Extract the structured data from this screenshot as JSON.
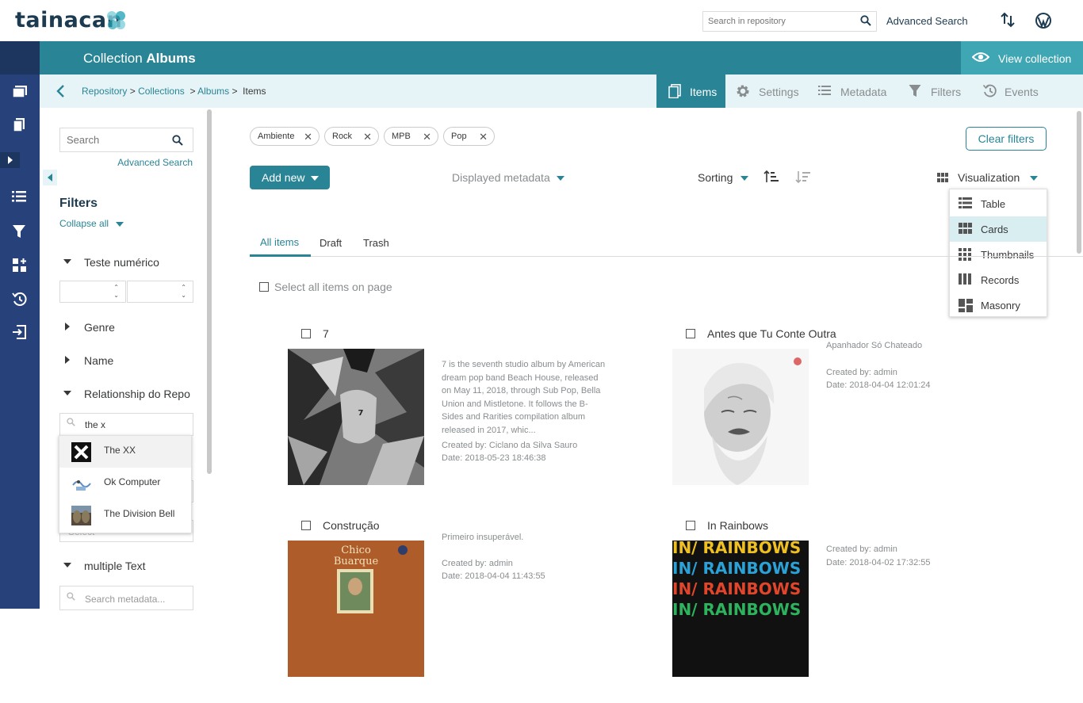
{
  "topbar": {
    "logo": "tainacan",
    "search_placeholder": "Search in repository",
    "advanced_search": "Advanced Search"
  },
  "collection_header": {
    "prefix": "Collection",
    "name": "Albums",
    "view_collection": "View collection"
  },
  "breadcrumb": {
    "repository": "Repository",
    "sep1": ">",
    "collections": "Collections",
    "sep2": ">",
    "albums": "Albums",
    "sep3": ">",
    "current": "Items"
  },
  "tabs": [
    {
      "label": "Items",
      "icon": "items-icon"
    },
    {
      "label": "Settings",
      "icon": "gear-icon"
    },
    {
      "label": "Metadata",
      "icon": "list-icon"
    },
    {
      "label": "Filters",
      "icon": "funnel-icon"
    },
    {
      "label": "Events",
      "icon": "history-icon"
    }
  ],
  "filters": {
    "search_placeholder": "Search",
    "advanced_search": "Advanced Search",
    "title": "Filters",
    "collapse_all": "Collapse all",
    "groups": [
      {
        "label": "Teste numérico",
        "expanded": true
      },
      {
        "label": "Genre",
        "expanded": false
      },
      {
        "label": "Name",
        "expanded": false
      },
      {
        "label": "Relationship do Repo",
        "expanded": true
      },
      {
        "label": "multiple Text",
        "expanded": true
      }
    ],
    "relationship_query": "the x",
    "relationship_results": [
      "The XX",
      "Ok Computer",
      "The Division Bell"
    ],
    "select_placeholder": "Select",
    "multi_placeholder": "Search metadata..."
  },
  "main": {
    "chips": [
      "Ambiente",
      "Rock",
      "MPB",
      "Pop"
    ],
    "clear_filters": "Clear filters",
    "add_new": "Add new",
    "displayed_metadata": "Displayed metadata",
    "sorting": "Sorting",
    "visualization": "Visualization",
    "visualization_options": [
      "Table",
      "Cards",
      "Thumbnails",
      "Records",
      "Masonry"
    ],
    "visualization_selected": "Cards",
    "status_tabs": [
      "All items",
      "Draft",
      "Trash"
    ],
    "select_all": "Select all items on page"
  },
  "items": [
    {
      "title": "7",
      "description": "7 is the seventh studio album by American dream pop band Beach House, released on May 11, 2018, through Sub Pop, Bella Union and Mistletone. It follows the B-Sides and Rarities compilation album released in 2017, whic...",
      "created_by": "Created by: Ciclano da Silva Sauro",
      "date": "Date: 2018-05-23 18:46:38"
    },
    {
      "title": "Antes que Tu Conte Outra",
      "description": "Apanhador Só Chateado",
      "created_by": "Created by: admin",
      "date": "Date: 2018-04-04 12:01:24"
    },
    {
      "title": "Construção",
      "description": "Primeiro insuperável.",
      "created_by": "Created by: admin",
      "date": "Date: 2018-04-04 11:43:55",
      "cover_text_1": "Chico",
      "cover_text_2": "Buarque"
    },
    {
      "title": "In Rainbows",
      "description": "",
      "created_by": "Created by: admin",
      "date": "Date: 2018-04-02 17:32:55",
      "cover_text": "IN/ RAINBOWS"
    }
  ],
  "colors": {
    "primary": "#298596",
    "nav": "#27427a",
    "light": "#e6f4f7"
  }
}
